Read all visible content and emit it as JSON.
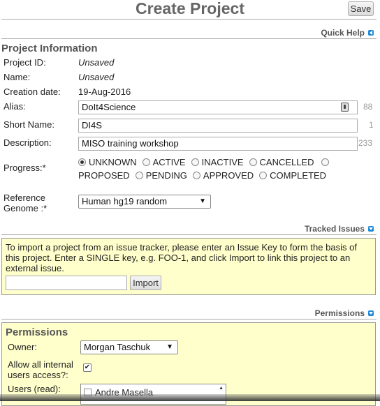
{
  "header": {
    "title": "Create Project",
    "save_label": "Save"
  },
  "quick_help": {
    "label": "Quick Help",
    "icon": "collapse-left-icon"
  },
  "project_info": {
    "heading": "Project Information",
    "project_id": {
      "label": "Project ID:",
      "value": "Unsaved"
    },
    "name": {
      "label": "Name:",
      "value": "Unsaved"
    },
    "creation_date": {
      "label": "Creation date:",
      "value": "19-Aug-2016"
    },
    "alias": {
      "label": "Alias:",
      "value": "DoIt4Science",
      "remaining": "88"
    },
    "short_name": {
      "label": "Short Name:",
      "value": "DI4S",
      "remaining": "1"
    },
    "description": {
      "label": "Description:",
      "value": "MISO training workshop",
      "remaining": "233"
    },
    "progress": {
      "label": "Progress:*",
      "selected": "UNKNOWN",
      "options_row1": [
        "UNKNOWN",
        "ACTIVE",
        "INACTIVE",
        "CANCELLED"
      ],
      "options_row2": [
        "PROPOSED",
        "PENDING",
        "APPROVED",
        "COMPLETED"
      ]
    },
    "reference_genome": {
      "label_line1": "Reference",
      "label_line2": "Genome :*",
      "value": "Human hg19 random"
    }
  },
  "tracked_issues": {
    "label": "Tracked Issues",
    "instructions": "To import a project from an issue tracker, please enter an Issue Key to form the basis of this project. Enter a SINGLE key, e.g. FOO-1, and click Import to link this project to an external issue.",
    "issue_key_value": "",
    "import_label": "Import"
  },
  "permissions": {
    "label": "Permissions",
    "heading": "Permissions",
    "owner": {
      "label": "Owner:",
      "value": "Morgan Taschuk"
    },
    "allow_internal": {
      "label_line1": "Allow all internal",
      "label_line2": "users access?:",
      "checked": true
    },
    "users_read": {
      "label": "Users (read):",
      "first_item": "Andre Masella"
    }
  },
  "colors": {
    "accent": "#1e88d6",
    "panel_bg": "#ffffcc",
    "heading": "#555555"
  }
}
